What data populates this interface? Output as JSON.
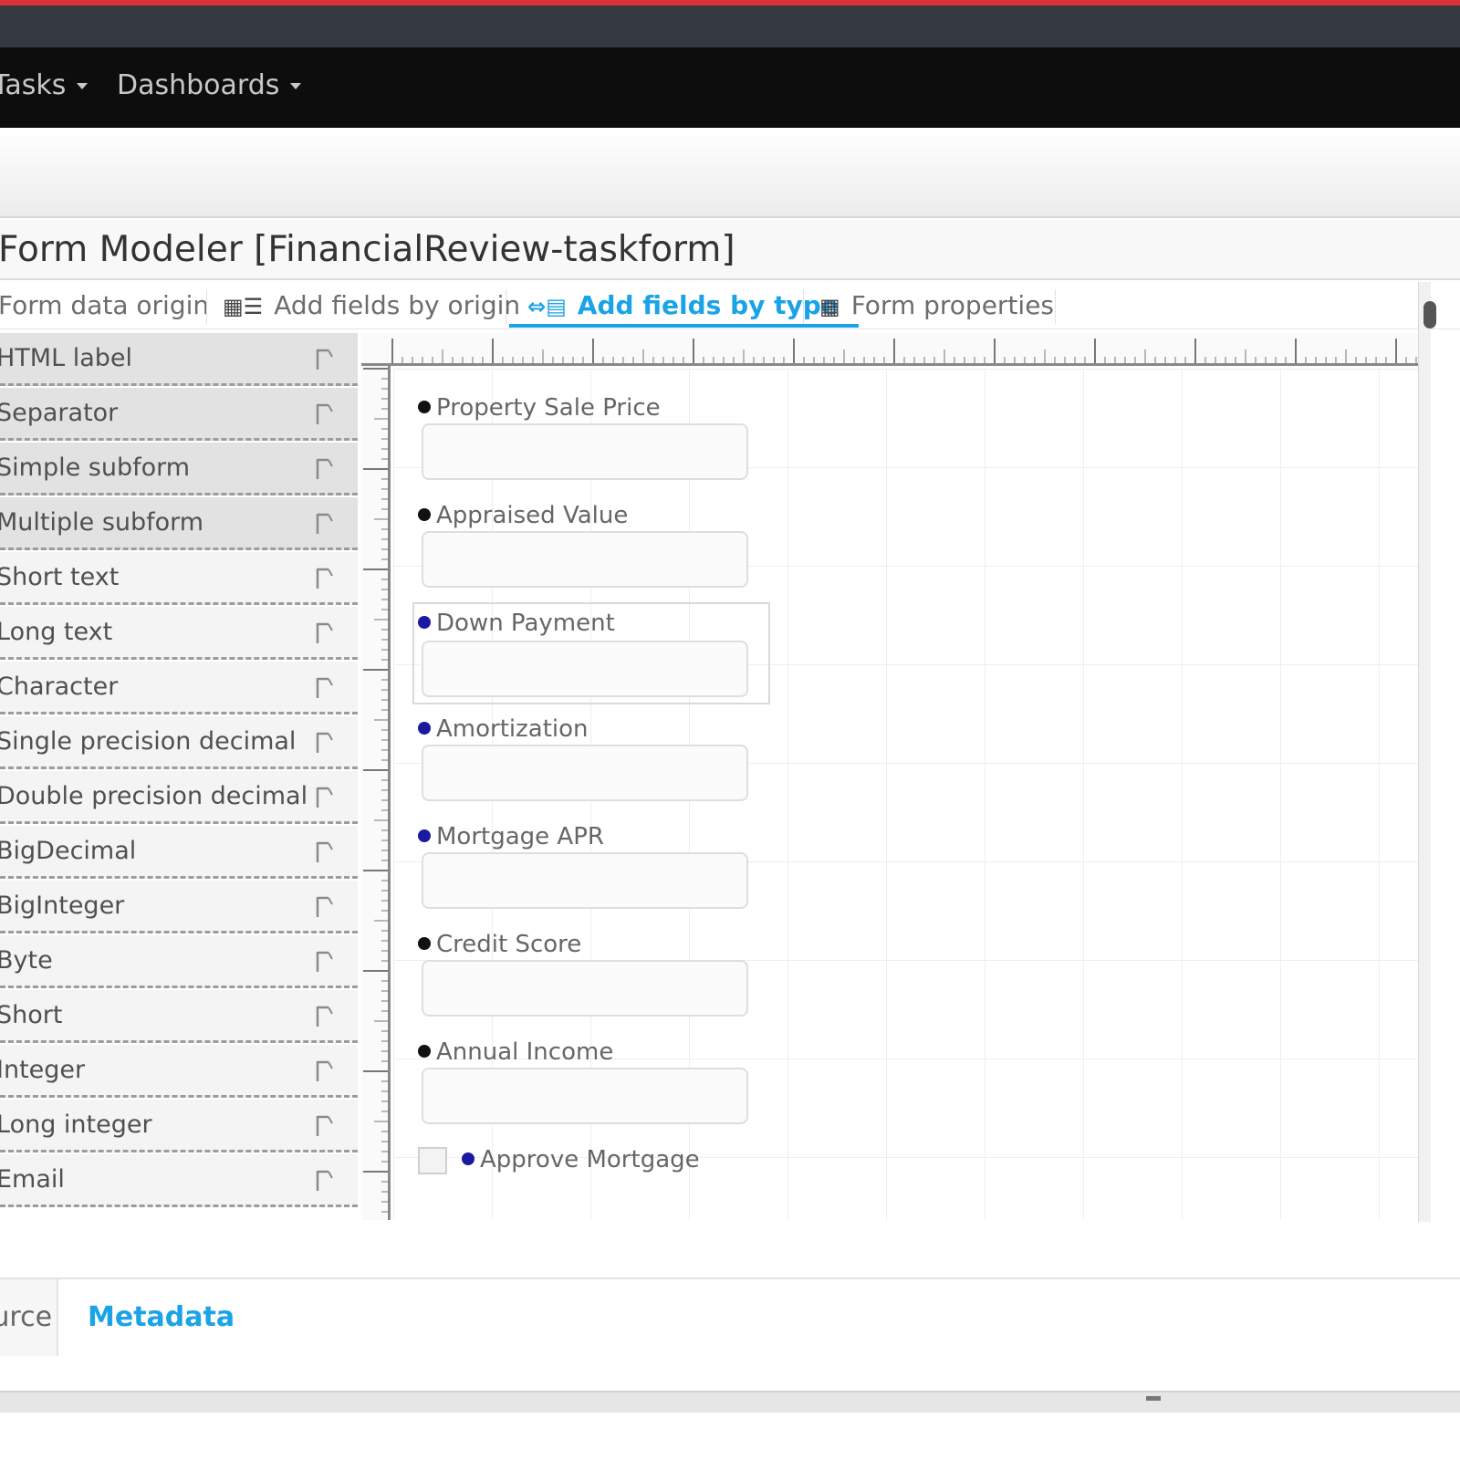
{
  "navbar": {
    "items": [
      {
        "label": "Tasks"
      },
      {
        "label": "Dashboards"
      }
    ]
  },
  "page": {
    "title": "Form Modeler [FinancialReview-taskform]"
  },
  "toolbar": {
    "tabs": [
      {
        "label": "Form data origin",
        "icon": "database-icon"
      },
      {
        "label": "Add fields by origin",
        "icon": "fields-origin-icon"
      },
      {
        "label": "Add fields by type",
        "icon": "fields-type-icon",
        "active": true
      },
      {
        "label": "Form properties",
        "icon": "form-properties-icon"
      }
    ]
  },
  "palette": {
    "items": [
      {
        "label": "HTML label"
      },
      {
        "label": "Separator"
      },
      {
        "label": "Simple subform"
      },
      {
        "label": "Multiple subform"
      },
      {
        "label": "Short text"
      },
      {
        "label": "Long text"
      },
      {
        "label": "Character"
      },
      {
        "label": "Single precision decimal"
      },
      {
        "label": "Double precision decimal"
      },
      {
        "label": "BigDecimal"
      },
      {
        "label": "BigInteger"
      },
      {
        "label": "Byte"
      },
      {
        "label": "Short"
      },
      {
        "label": "Integer"
      },
      {
        "label": "Long integer"
      },
      {
        "label": "Email"
      }
    ]
  },
  "form": {
    "fields": [
      {
        "label": "Property Sale Price",
        "marker": "black"
      },
      {
        "label": "Appraised Value",
        "marker": "black"
      },
      {
        "label": "Down Payment",
        "marker": "blue"
      },
      {
        "label": "Amortization",
        "marker": "blue"
      },
      {
        "label": "Mortgage APR",
        "marker": "blue"
      },
      {
        "label": "Credit Score",
        "marker": "black"
      },
      {
        "label": "Annual Income",
        "marker": "black"
      }
    ],
    "checkbox": {
      "label": "Approve Mortgage",
      "marker": "blue",
      "checked": false
    }
  },
  "bottom_tabs": [
    {
      "label": "Source"
    },
    {
      "label": "Metadata",
      "active": true
    }
  ],
  "colors": {
    "accent": "#1aa3e6",
    "navbar": "#0d0d0d",
    "topline": "#d9303a",
    "required_marker": "#1a1aa0"
  }
}
